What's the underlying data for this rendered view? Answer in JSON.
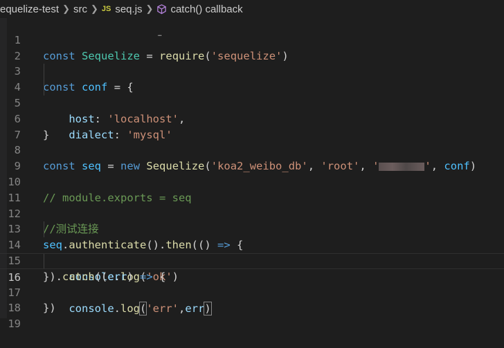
{
  "breadcrumb": {
    "folder": "equelize-test",
    "subfolder": "src",
    "file_badge": "JS",
    "file": "seq.js",
    "symbol": "catch() callback"
  },
  "editor": {
    "lines": [
      {
        "n": "1"
      },
      {
        "n": "2"
      },
      {
        "n": "3"
      },
      {
        "n": "4"
      },
      {
        "n": "5"
      },
      {
        "n": "6"
      },
      {
        "n": "7"
      },
      {
        "n": "8"
      },
      {
        "n": "9"
      },
      {
        "n": "10"
      },
      {
        "n": "11"
      },
      {
        "n": "12"
      },
      {
        "n": "13"
      },
      {
        "n": "14"
      },
      {
        "n": "15"
      },
      {
        "n": "16"
      },
      {
        "n": "17"
      },
      {
        "n": "18"
      },
      {
        "n": "19"
      }
    ],
    "active_line": 16
  },
  "tokens": {
    "const": "const",
    "new": "new",
    "Sequelize": "Sequelize",
    "require": "require",
    "sequelize_str": "'sequelize'",
    "conf": "conf",
    "host": "host",
    "localhost_str": "'localhost'",
    "dialect": "dialect",
    "mysql_str": "'mysql'",
    "seq": "seq",
    "db_str": "'koa2_weibo_db'",
    "root_str": "'root'",
    "quote": "'",
    "comment_exports": "// module.exports = seq",
    "comment_cn": "//测试连接",
    "authenticate": "authenticate",
    "then": "then",
    "console": "console",
    "log": "log",
    "ok_str": "'ok'",
    "catch": "catch",
    "err": "err",
    "err_str": "'err'"
  },
  "colors": {
    "background": "#1e1e1e",
    "keyword": "#569cd6",
    "string": "#ce9178",
    "class": "#4ec9b0",
    "function": "#dcdcaa",
    "variable": "#9cdcfe",
    "comment": "#6a9955"
  }
}
